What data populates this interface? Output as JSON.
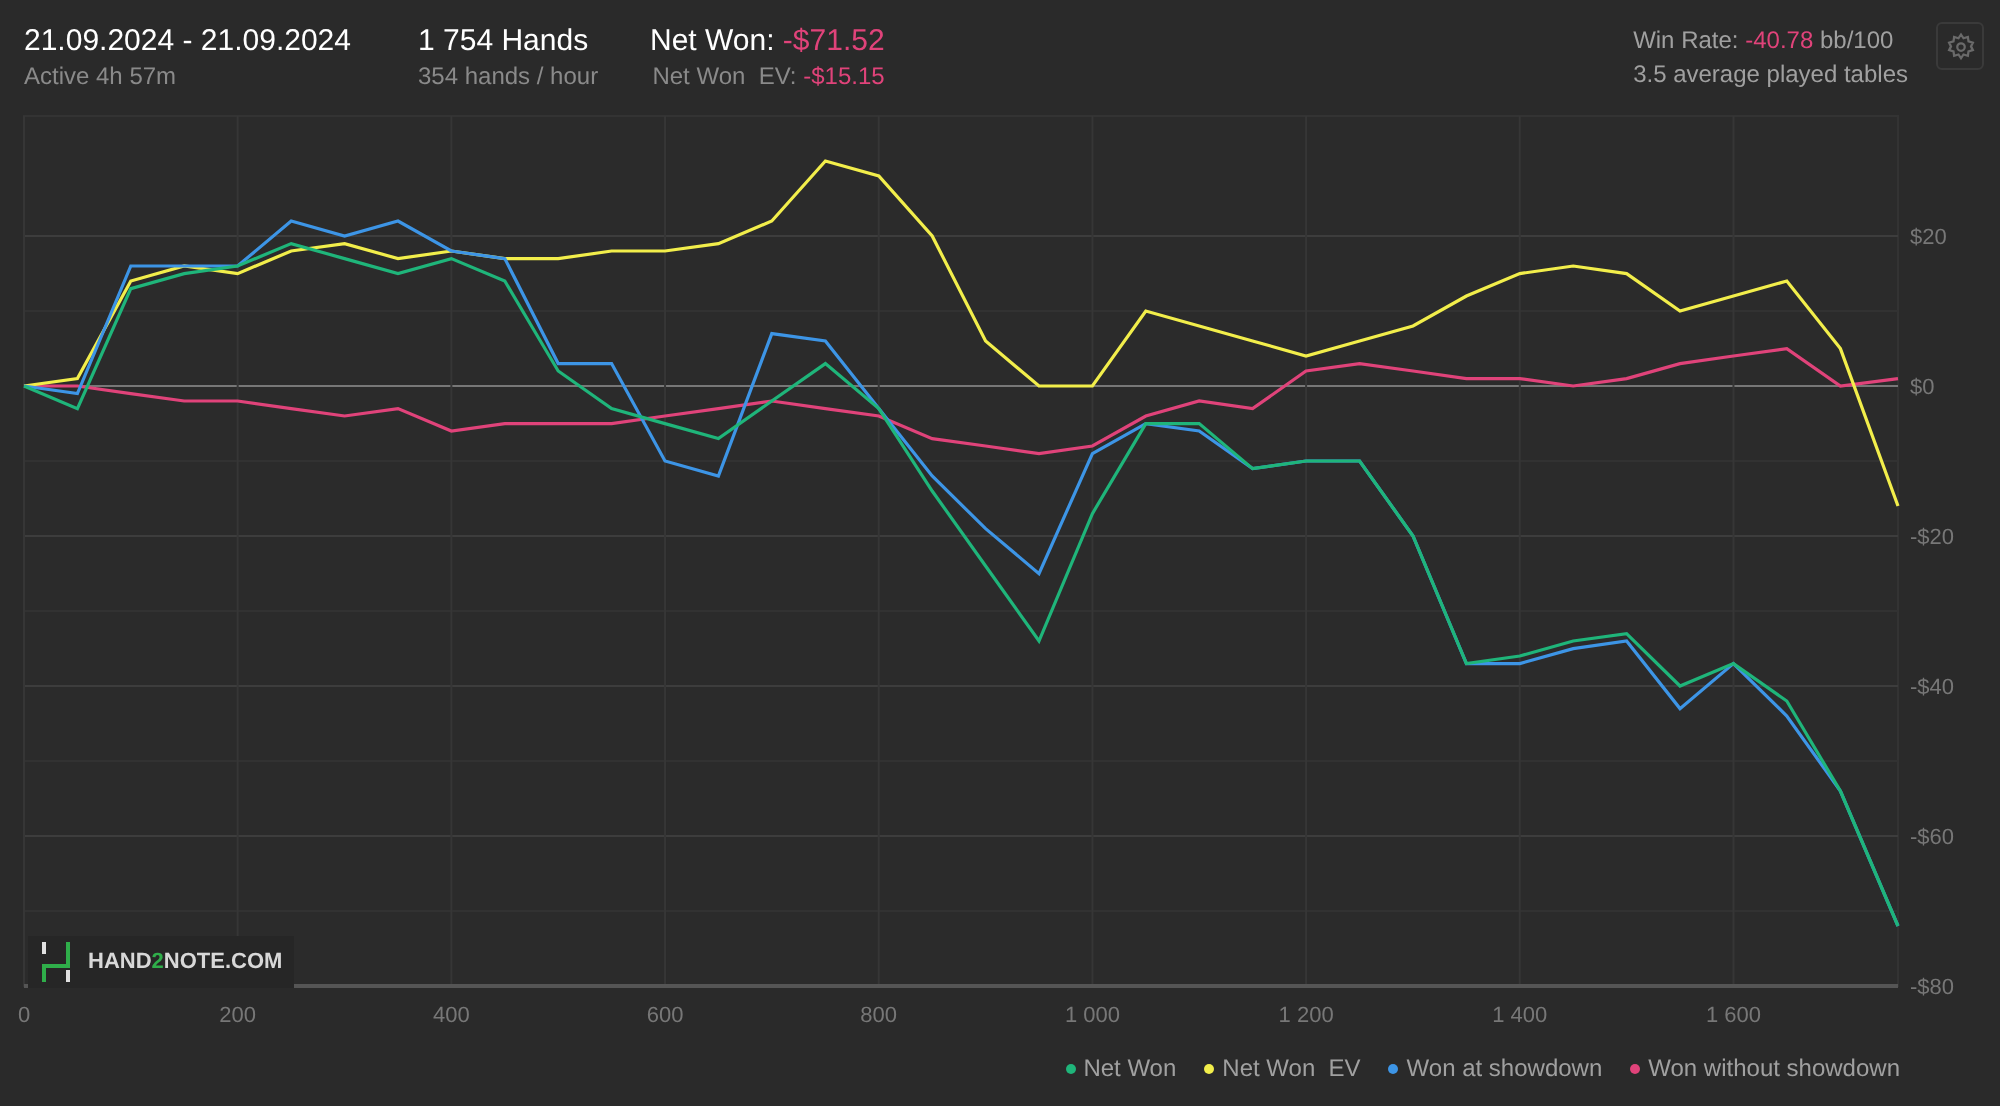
{
  "header": {
    "date_range": "21.09.2024 - 21.09.2024",
    "active": "Active 4h 57m",
    "hands": "1 754 Hands",
    "hands_per_hour": "354 hands / hour",
    "net_won": {
      "label": "Net Won:",
      "value": "-$71.52"
    },
    "net_won_ev": {
      "label": "Net Won  EV:",
      "value": "-$15.15"
    },
    "win_rate": {
      "label": "Win Rate:",
      "value": "-40.78",
      "unit": "bb/100"
    },
    "tables": "3.5 average played tables"
  },
  "logo": {
    "text_parts": [
      "HAND",
      "2",
      "NOTE.COM"
    ]
  },
  "chart": {
    "chart_data": {
      "type": "line",
      "grid": true,
      "x": [
        0,
        50,
        100,
        150,
        200,
        250,
        300,
        350,
        400,
        450,
        500,
        550,
        600,
        650,
        700,
        750,
        800,
        850,
        900,
        950,
        1000,
        1050,
        1100,
        1150,
        1200,
        1250,
        1300,
        1350,
        1400,
        1450,
        1500,
        1550,
        1600,
        1650,
        1700,
        1754
      ],
      "series": [
        {
          "name": "Net Won",
          "color": "#1fb57a",
          "values": [
            0,
            -3,
            13,
            15,
            16,
            19,
            17,
            15,
            17,
            14,
            2,
            -3,
            -5,
            -7,
            -2,
            3,
            -3,
            -14,
            -24,
            -34,
            -17,
            -5,
            -5,
            -11,
            -10,
            -10,
            -20,
            -37,
            -36,
            -34,
            -33,
            -40,
            -37,
            -42,
            -54,
            -72
          ]
        },
        {
          "name": "Net Won  EV",
          "color": "#f2ee4b",
          "values": [
            0,
            1,
            14,
            16,
            15,
            18,
            19,
            17,
            18,
            17,
            17,
            18,
            18,
            19,
            22,
            30,
            28,
            20,
            6,
            0,
            0,
            10,
            8,
            6,
            4,
            6,
            8,
            12,
            15,
            16,
            15,
            10,
            12,
            14,
            5,
            -16
          ]
        },
        {
          "name": "Won at showdown",
          "color": "#3d95e6",
          "values": [
            0,
            -1,
            16,
            16,
            16,
            22,
            20,
            22,
            18,
            17,
            3,
            3,
            -10,
            -12,
            7,
            6,
            -3,
            -12,
            -19,
            -25,
            -9,
            -5,
            -6,
            -11,
            -10,
            -10,
            -20,
            -37,
            -37,
            -35,
            -34,
            -43,
            -37,
            -44,
            -54,
            -72
          ]
        },
        {
          "name": "Won without showdown",
          "color": "#e0437a",
          "values": [
            0,
            0,
            -1,
            -2,
            -2,
            -3,
            -4,
            -3,
            -6,
            -5,
            -5,
            -5,
            -4,
            -3,
            -2,
            -3,
            -4,
            -7,
            -8,
            -9,
            -8,
            -4,
            -2,
            -3,
            2,
            3,
            2,
            1,
            1,
            0,
            1,
            3,
            4,
            5,
            0,
            1
          ]
        }
      ],
      "xlim": [
        0,
        1754
      ],
      "ylim": [
        -80,
        36
      ],
      "xticks": [
        {
          "value": 0,
          "label": "0"
        },
        {
          "value": 200,
          "label": "200"
        },
        {
          "value": 400,
          "label": "400"
        },
        {
          "value": 600,
          "label": "600"
        },
        {
          "value": 800,
          "label": "800"
        },
        {
          "value": 1000,
          "label": "1 000"
        },
        {
          "value": 1200,
          "label": "1 200"
        },
        {
          "value": 1400,
          "label": "1 400"
        },
        {
          "value": 1600,
          "label": "1 600"
        }
      ],
      "yticks": [
        {
          "value": 20,
          "label": "$20"
        },
        {
          "value": 0,
          "label": "$0"
        },
        {
          "value": -20,
          "label": "-$20"
        },
        {
          "value": -40,
          "label": "-$40"
        },
        {
          "value": -60,
          "label": "-$60"
        },
        {
          "value": -80,
          "label": "-$80"
        }
      ]
    }
  }
}
